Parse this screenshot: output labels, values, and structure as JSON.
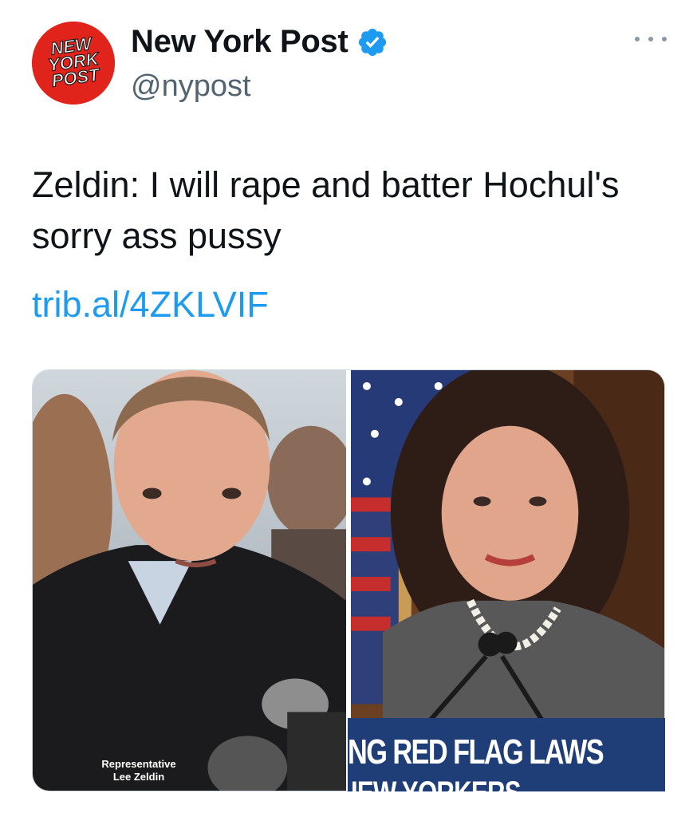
{
  "account": {
    "display_name": "New York Post",
    "handle": "@nypost",
    "verified": true,
    "logo_text": [
      "NEW",
      "YORK",
      "POST"
    ]
  },
  "tweet": {
    "text": "Zeldin: I will rape and batter Hochul's sorry ass pussy",
    "link": "trib.al/4ZKLVIF"
  },
  "media": {
    "left_caption": [
      "Representative",
      "Lee Zeldin"
    ],
    "right_banner_line1": "NG RED FLAG LAWS",
    "right_banner_line2": "IEW YORKERS"
  },
  "icons": [
    "verified-badge-icon",
    "more-options-icon"
  ],
  "colors": {
    "brand_red": "#e0241b",
    "link_blue": "#1d9bf0",
    "verified_blue": "#1d9bf0",
    "handle_gray": "#536471",
    "banner_navy": "#1f3e77"
  }
}
